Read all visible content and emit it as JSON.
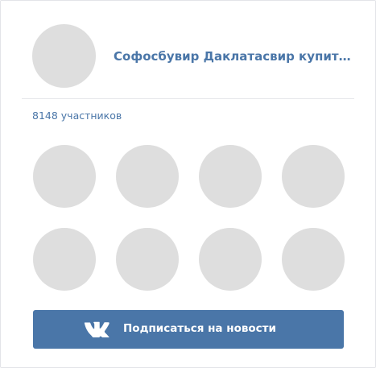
{
  "group": {
    "name": "Софосбувир Даклатасвир купить...",
    "members_count": "8148 участников"
  },
  "subscribe_button": {
    "label": "Подписаться на новости"
  },
  "colors": {
    "accent": "#4a76a8",
    "placeholder_avatar": "#dedede",
    "border": "#e3e4e8"
  },
  "icons": {
    "logo": "vk-logo-icon"
  }
}
